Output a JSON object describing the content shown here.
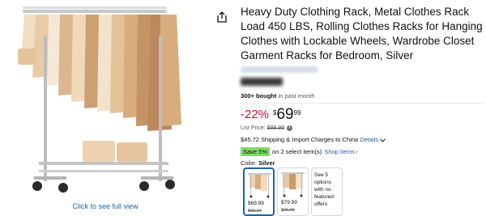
{
  "product": {
    "title": "Heavy Duty Clothing Rack, Metal Clothes Rack Load 450 LBS, Rolling Clothes Racks for Hanging Clothes with Lockable Wheels, Wardrobe Closet Garment Racks for Bedroom, Silver",
    "bought_count": "300+ bought",
    "bought_suffix": " in past month"
  },
  "gallery": {
    "full_view_label": "Click to see full view"
  },
  "price": {
    "discount": "-22%",
    "currency": "$",
    "whole": "69",
    "fraction": "99",
    "list_label": "List Price:",
    "list_value": "$89.99"
  },
  "shipping": {
    "text": "$45.72 Shipping & Import Charges to China",
    "details_link": "Details"
  },
  "promo": {
    "badge": "Save 5%",
    "text": "on 2 select item(s)",
    "shop_link": "Shop items"
  },
  "color": {
    "label": "Color:",
    "value": "Silver",
    "swatches": [
      {
        "price": "$69.99",
        "list": "$89.99",
        "selected": true
      },
      {
        "price": "$79.99",
        "list": "$99.99",
        "selected": false
      },
      {
        "note": "See 5 options with no featured offers",
        "selected": false
      }
    ]
  },
  "colors": {
    "link": "#2162a1",
    "discount": "#cc0c39",
    "save_badge": "#7fda69"
  },
  "icons": {
    "share": "share-icon",
    "info": "info-icon",
    "chevron": "chevron-down-icon"
  }
}
